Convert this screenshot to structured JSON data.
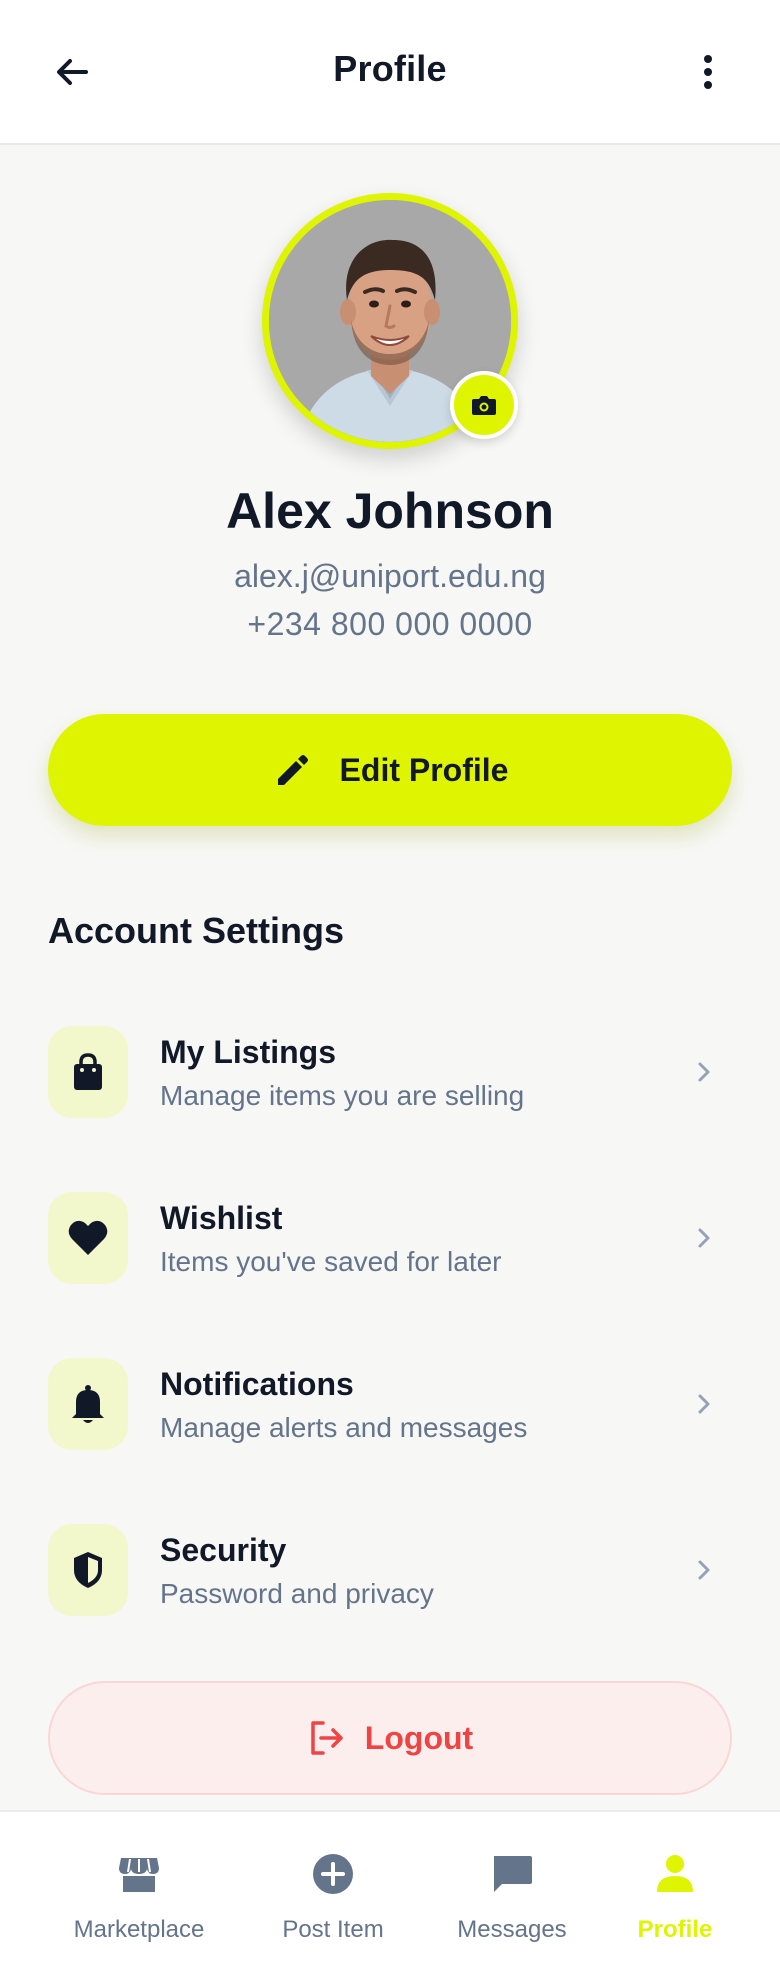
{
  "header": {
    "title": "Profile",
    "back_icon": "arrow-left-icon",
    "more_icon": "more-vertical-icon"
  },
  "profile": {
    "name": "Alex Johnson",
    "email": "alex.j@uniport.edu.ng",
    "phone": "+234 800 000 0000",
    "avatar_icon": "user-photo",
    "camera_icon": "camera-icon"
  },
  "edit_button": {
    "label": "Edit Profile",
    "icon": "pencil-icon"
  },
  "account_settings": {
    "title": "Account Settings",
    "items": [
      {
        "title": "My Listings",
        "subtitle": "Manage items you are selling",
        "icon": "shopping-bag-icon"
      },
      {
        "title": "Wishlist",
        "subtitle": "Items you've saved for later",
        "icon": "heart-icon"
      },
      {
        "title": "Notifications",
        "subtitle": "Manage alerts and messages",
        "icon": "bell-icon"
      },
      {
        "title": "Security",
        "subtitle": "Password and privacy",
        "icon": "shield-icon"
      }
    ]
  },
  "logout": {
    "label": "Logout",
    "icon": "logout-icon"
  },
  "bottom_nav": {
    "items": [
      {
        "label": "Marketplace",
        "icon": "store-icon",
        "active": false
      },
      {
        "label": "Post Item",
        "icon": "plus-circle-icon",
        "active": false
      },
      {
        "label": "Messages",
        "icon": "chat-icon",
        "active": false
      },
      {
        "label": "Profile",
        "icon": "user-icon",
        "active": true
      }
    ]
  },
  "colors": {
    "accent": "#dff400",
    "text_primary": "#111827",
    "text_secondary": "#64748b",
    "danger": "#ef4444",
    "danger_bg": "#fdeeee",
    "icon_bg": "#f2f8cc",
    "background": "#f7f7f5"
  }
}
